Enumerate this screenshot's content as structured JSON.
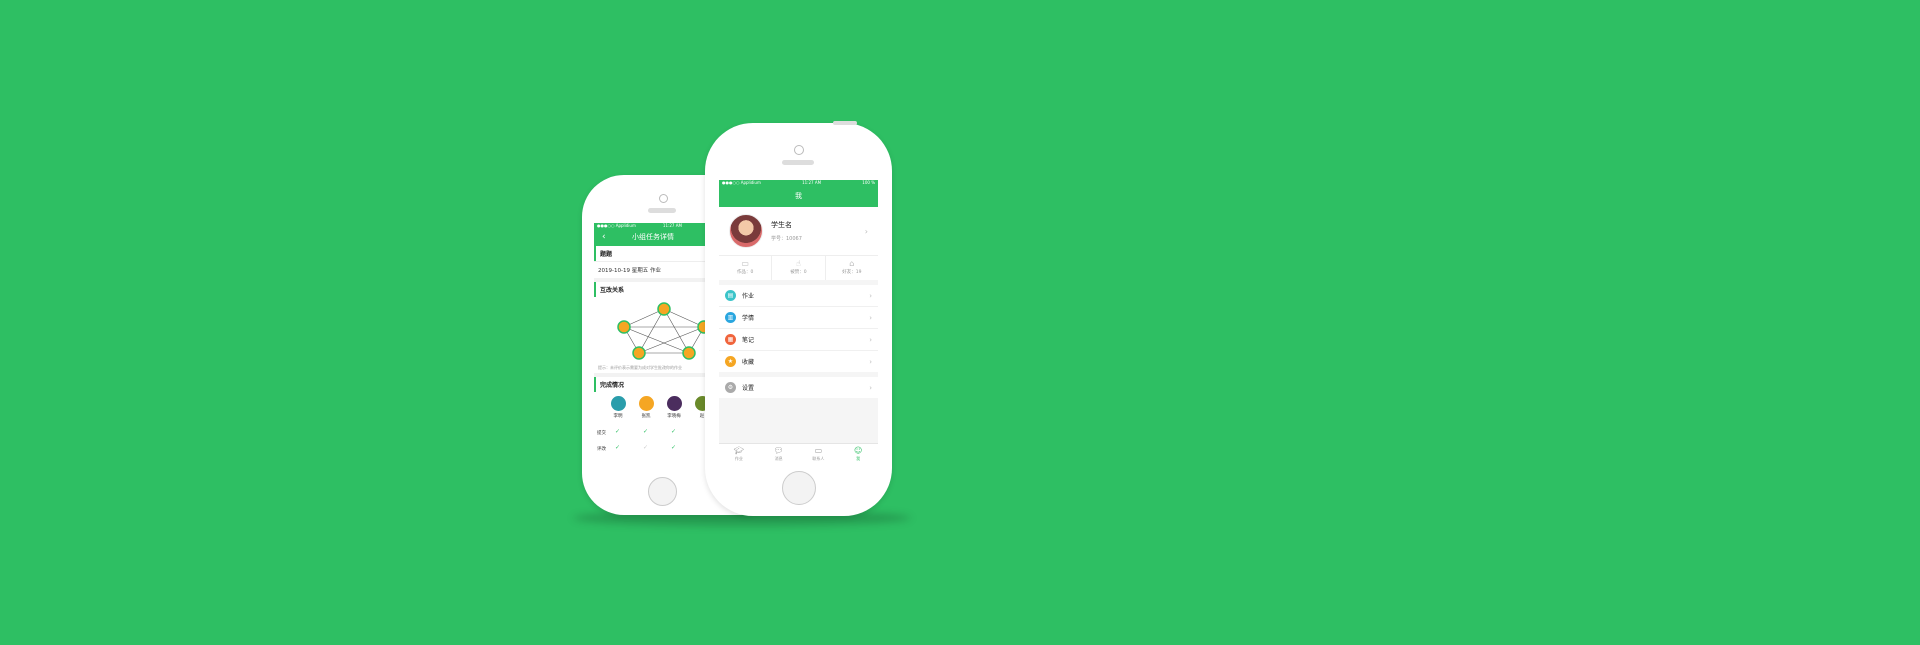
{
  "colors": {
    "brand": "#2ebf63",
    "background": "#2ebf63"
  },
  "back_phone": {
    "status": {
      "carrier": "●●●○○ Applidium",
      "time": "11:27 AM"
    },
    "nav_title": "小组任务详情",
    "sections": {
      "topic_title": "题题",
      "topic_text": "2019-10-19 星期五 作业",
      "relation_title": "互改关系",
      "relation_hint": "提示：未评价表示需要为成对学生批改你的作业",
      "completion_title": "完成情况"
    },
    "members": [
      "李明",
      "张凯",
      "李晓梅",
      "赵"
    ],
    "rows": [
      "提交",
      "评改"
    ]
  },
  "front_phone": {
    "status": {
      "carrier": "●●●○○ Applidium",
      "time": "11:27 AM",
      "battery": "100 %"
    },
    "nav_title": "我",
    "profile": {
      "name": "学生名",
      "student_id": "学号：10067"
    },
    "stats": [
      {
        "label": "作品：0",
        "icon": "book-icon"
      },
      {
        "label": "被赞：0",
        "icon": "thumb-icon"
      },
      {
        "label": "好友：19",
        "icon": "bookmark-icon"
      }
    ],
    "menu": [
      {
        "label": "作业",
        "icon": "homework-icon",
        "color": "#3bc4c9"
      },
      {
        "label": "学情",
        "icon": "chart-icon",
        "color": "#2aa6df"
      },
      {
        "label": "笔记",
        "icon": "note-icon",
        "color": "#f0643c"
      },
      {
        "label": "收藏",
        "icon": "star-icon",
        "color": "#f5a623"
      }
    ],
    "settings_label": "设置",
    "tabs": [
      {
        "label": "作业",
        "icon": "cap-icon"
      },
      {
        "label": "消息",
        "icon": "chat-icon"
      },
      {
        "label": "联系人",
        "icon": "contacts-icon"
      },
      {
        "label": "我",
        "icon": "person-icon"
      }
    ]
  }
}
